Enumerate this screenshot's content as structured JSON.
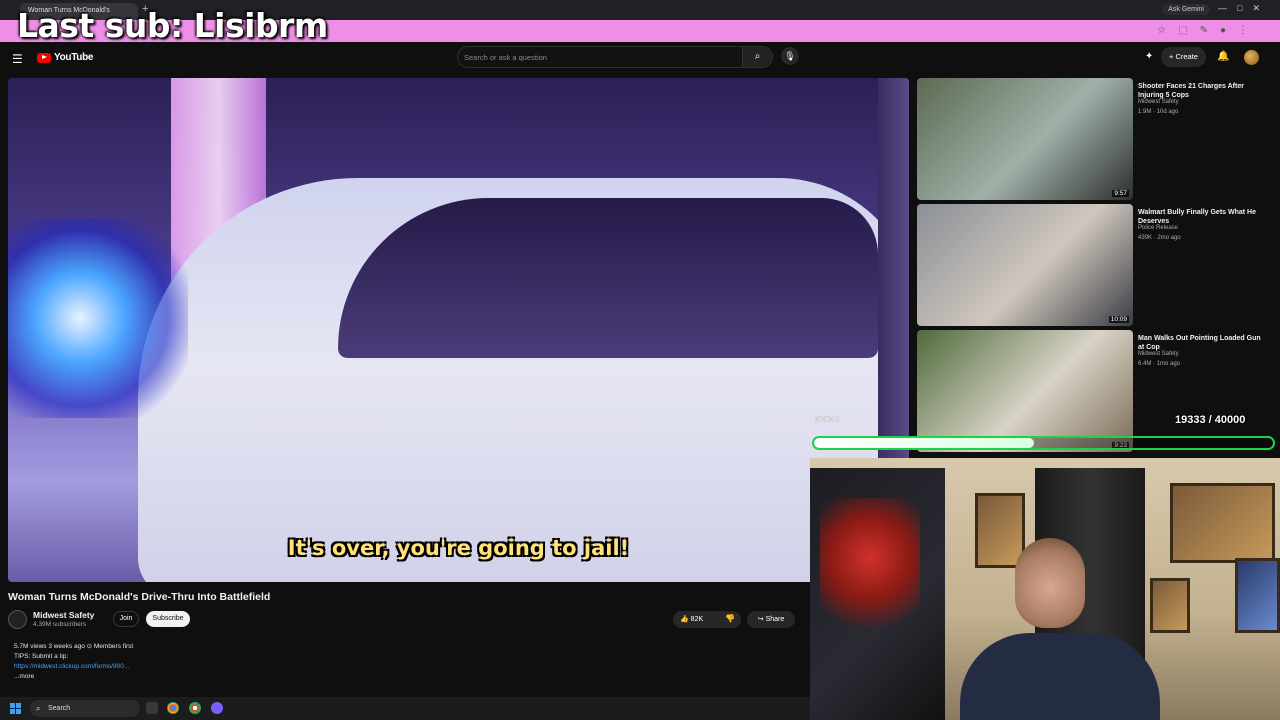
{
  "browser": {
    "tab_title": "Woman Turns McDonald's",
    "ask_gemini": "Ask Gemini"
  },
  "overlay": {
    "last_sub": "Last sub: Lisibrm",
    "goal_label": "KICKS",
    "goal_count": "19333 / 40000",
    "goal_fraction": 0.48
  },
  "header": {
    "logo_text": "YouTube",
    "search_placeholder": "Search or ask a question",
    "create_label": "Create"
  },
  "player": {
    "caption": "It's over, you're going to jail!"
  },
  "video": {
    "title": "Woman Turns McDonald's Drive-Thru Into Battlefield",
    "channel": "Midwest Safety",
    "subscribers": "4.39M subscribers",
    "join_label": "Join",
    "subscribe_label": "Subscribe",
    "likes": "82K",
    "share_label": "Share",
    "stats": "5.7M views  3 weeks ago  ⊙ Members first",
    "tips": "TIPS: Submit a tip:",
    "link": "https://midwest.clickup.com/forms/900...",
    "more": "...more"
  },
  "recommendations": [
    {
      "title": "Shooter Faces 21 Charges After Injuring 5 Cops",
      "channel": "Midwest Safety",
      "meta": "1.9M · 10d ago",
      "duration": "9:57",
      "colors": [
        "#5c6a52",
        "#9fb0a8",
        "#2d2f2c"
      ]
    },
    {
      "title": "Walmart Bully Finally Gets What He Deserves",
      "channel": "Police Release",
      "meta": "439K · 2mo ago",
      "duration": "10:09",
      "colors": [
        "#8b8f97",
        "#cfc7bd",
        "#3a3c44"
      ]
    },
    {
      "title": "Man Walks Out Pointing Loaded Gun at Cop",
      "channel": "Midwest Safety",
      "meta": "6.4M · 1mo ago",
      "duration": "9:23",
      "colors": [
        "#4e6a3c",
        "#d8d3c6",
        "#7a6a55"
      ]
    }
  ],
  "taskbar": {
    "search_label": "Search"
  }
}
